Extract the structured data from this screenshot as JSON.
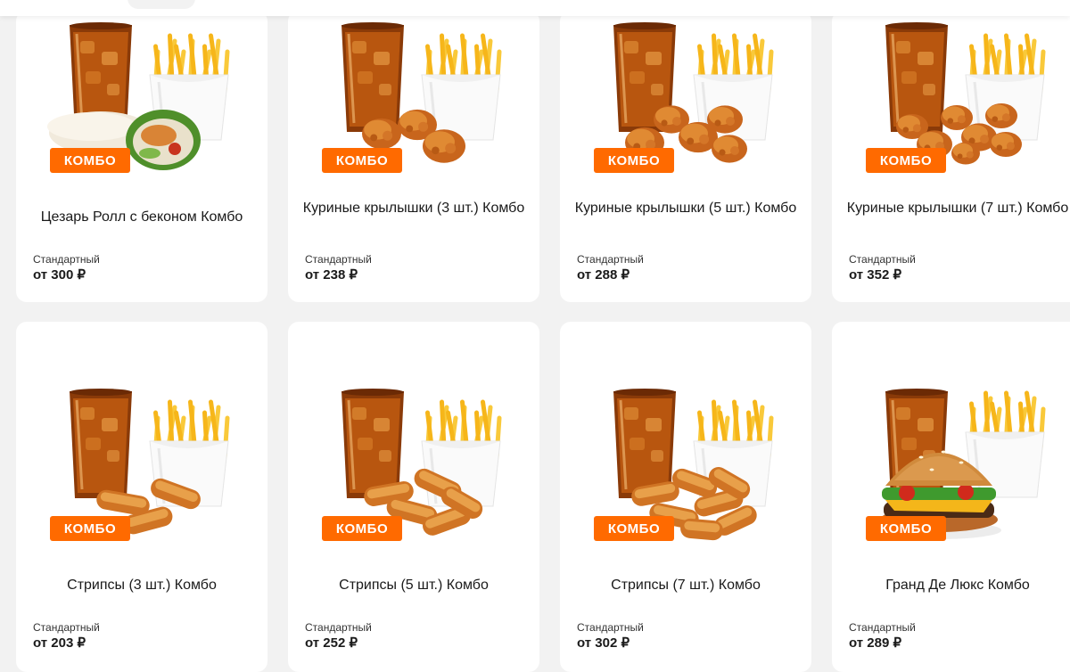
{
  "badge_label": "КОМБО",
  "brand_color": "#ff6a00",
  "products": [
    {
      "name": "Цезарь Ролл с беконом Комбо",
      "size": "Стандартный",
      "price": "от 300 ₽",
      "food": "caesar-roll"
    },
    {
      "name": "Куриные крылышки (3 шт.) Комбо",
      "size": "Стандартный",
      "price": "от 238 ₽",
      "food": "wings-3"
    },
    {
      "name": "Куриные крылышки (5 шт.) Комбо",
      "size": "Стандартный",
      "price": "от 288 ₽",
      "food": "wings-5"
    },
    {
      "name": "Куриные крылышки (7 шт.) Комбо",
      "size": "Стандартный",
      "price": "от 352 ₽",
      "food": "wings-7"
    },
    {
      "name": "Стрипсы (3 шт.) Комбо",
      "size": "Стандартный",
      "price": "от 203 ₽",
      "food": "strips-3"
    },
    {
      "name": "Стрипсы (5 шт.) Комбо",
      "size": "Стандартный",
      "price": "от 252 ₽",
      "food": "strips-5"
    },
    {
      "name": "Стрипсы (7 шт.) Комбо",
      "size": "Стандартный",
      "price": "от 302 ₽",
      "food": "strips-7"
    },
    {
      "name": "Гранд Де Люкс Комбо",
      "size": "Стандартный",
      "price": "от 289 ₽",
      "food": "burger"
    }
  ]
}
